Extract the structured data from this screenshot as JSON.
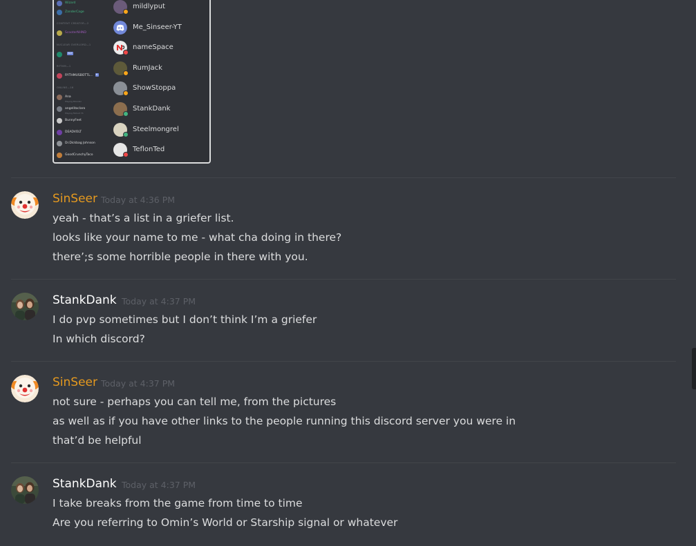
{
  "attachment": {
    "left_column": {
      "rows": [
        {
          "kind": "row",
          "text": "Wizard",
          "color": "#43b581",
          "avatar": "#5a6fb6"
        },
        {
          "kind": "row",
          "text": "ZanderCage",
          "color": "#43b581",
          "avatar": "#3b6ea8"
        },
        {
          "kind": "head",
          "text": "CONTENT CREATOR—2"
        },
        {
          "kind": "row",
          "text": "ScooterNHND",
          "color": "#9b59b6",
          "avatar": "#b8a94a"
        },
        {
          "kind": "head",
          "text": "NUCLEAR OVERLORD—1"
        },
        {
          "kind": "row",
          "text": "",
          "color": "#e03e3e",
          "avatar": "#1f8a6b",
          "tag": "BOT"
        },
        {
          "kind": "head",
          "text": "RYTHM—1"
        },
        {
          "kind": "row",
          "text": "RYTHMUSBOTTL...",
          "color": "#dcddde",
          "avatar": "#c2445b",
          "tag": "B"
        },
        {
          "kind": "head",
          "text": "ONLINE—16"
        },
        {
          "kind": "row",
          "text": "Ana",
          "color": "#dcddde",
          "avatar": "#8a6a5a",
          "sub": "Playing Monster"
        },
        {
          "kind": "row",
          "text": "angelitoclaro",
          "color": "#dcddde",
          "avatar": "#777c85",
          "sub": "Playing Fallout 76"
        },
        {
          "kind": "row",
          "text": "BunnyFeet",
          "color": "#dcddde",
          "avatar": "#c9c9c9"
        },
        {
          "kind": "row",
          "text": "DEADVOLT",
          "color": "#dcddde",
          "avatar": "#6f3fa5"
        },
        {
          "kind": "row",
          "text": "Dr.Dickbag Johnson",
          "color": "#dcddde",
          "avatar": "#8e9297"
        },
        {
          "kind": "row",
          "text": "GoodCrunchyTaco",
          "color": "#dcddde",
          "avatar": "#c17d3a"
        }
      ]
    },
    "members": [
      {
        "name": "mildlyput",
        "avatar": "#6b5b7a",
        "status": "#faa61a"
      },
      {
        "name": "Me_Sinseer-YT",
        "avatar": "#7289da",
        "status": "",
        "icon": "discord-logo-icon"
      },
      {
        "name": "nameSpace",
        "avatar": "#e8e8e8",
        "status": "#f04747",
        "icon": "ns-logo-icon"
      },
      {
        "name": "RumJack",
        "avatar": "#5e5a3a",
        "status": "#faa61a"
      },
      {
        "name": "ShowStoppa",
        "avatar": "#8a8f96",
        "status": "#faa61a"
      },
      {
        "name": "StankDank",
        "avatar": "#8c6e4e",
        "status": "#43b581"
      },
      {
        "name": "Steelmongrel",
        "avatar": "#d9d3c0",
        "status": "#43b581"
      },
      {
        "name": "TeflonTed",
        "avatar": "#e6e6e6",
        "status": "#f04747"
      }
    ]
  },
  "messages": [
    {
      "author": "SinSeer",
      "author_color": "#e69a1f",
      "avatar_icon": "clown-face-icon",
      "timestamp": "Today at 4:36 PM",
      "lines": [
        "yeah - that’s a list in a griefer list.",
        "looks like your name to me - what cha doing in there?",
        "there’;s some horrible people in there with you."
      ]
    },
    {
      "author": "StankDank",
      "author_color": "#ffffff",
      "avatar_icon": "user-photo-icon",
      "timestamp": "Today at 4:37 PM",
      "lines": [
        "I do pvp sometimes but I don’t think I’m a griefer",
        "In which discord?"
      ]
    },
    {
      "author": "SinSeer",
      "author_color": "#e69a1f",
      "avatar_icon": "clown-face-icon",
      "timestamp": "Today at 4:37 PM",
      "lines": [
        "not sure - perhaps you can tell me, from the pictures",
        "as well as if you have other links to the people running this discord server you were in",
        "that’d be helpful"
      ]
    },
    {
      "author": "StankDank",
      "author_color": "#ffffff",
      "avatar_icon": "user-photo-icon",
      "timestamp": "Today at 4:37 PM",
      "lines": [
        "I take breaks from the game from time to time",
        "Are you referring to Omin’s World or Starship signal or whatever"
      ]
    }
  ],
  "colors": {
    "background": "#36393f",
    "text": "#dcddde",
    "timestamp": "#5d6067",
    "divider": "#42454a"
  }
}
